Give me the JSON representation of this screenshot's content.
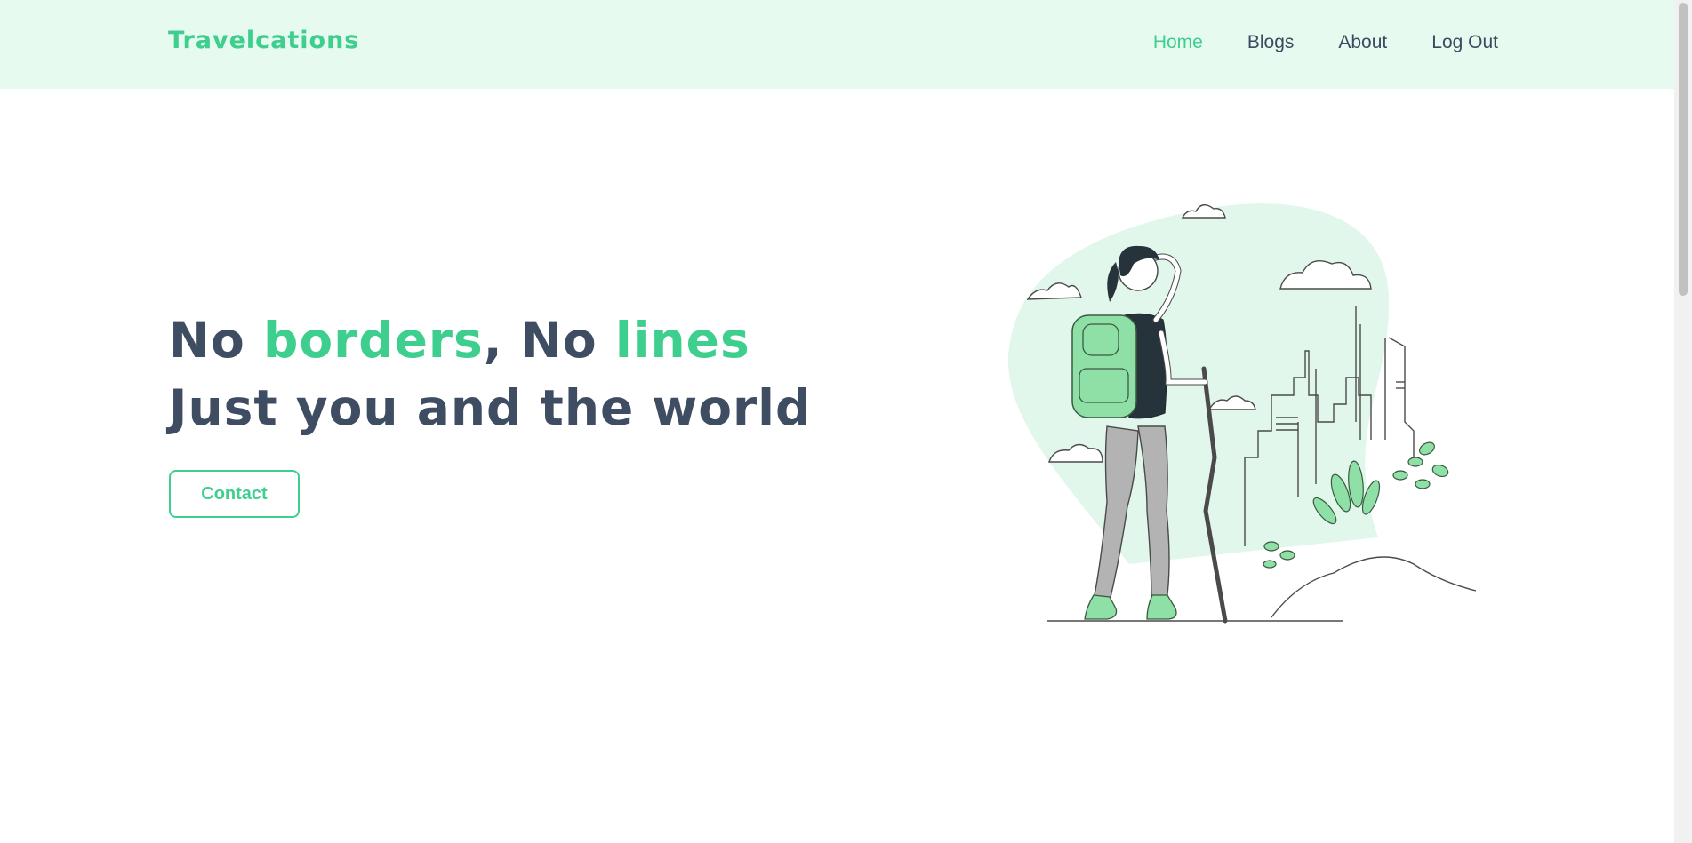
{
  "brand": {
    "name": "Travelcations"
  },
  "nav": {
    "items": [
      {
        "label": "Home",
        "active": true
      },
      {
        "label": "Blogs",
        "active": false
      },
      {
        "label": "About",
        "active": false
      },
      {
        "label": "Log Out",
        "active": false
      }
    ]
  },
  "hero": {
    "line1": {
      "part1": "No ",
      "accent1": "borders",
      "part2": ", No ",
      "accent2": "lines"
    },
    "line2": "Just you and the world",
    "cta_label": "Contact"
  },
  "illustration": {
    "icon": "hiker-illustration"
  },
  "colors": {
    "accent": "#3ecf8e",
    "header_bg": "#e6faf0",
    "text": "#3f4d63"
  }
}
